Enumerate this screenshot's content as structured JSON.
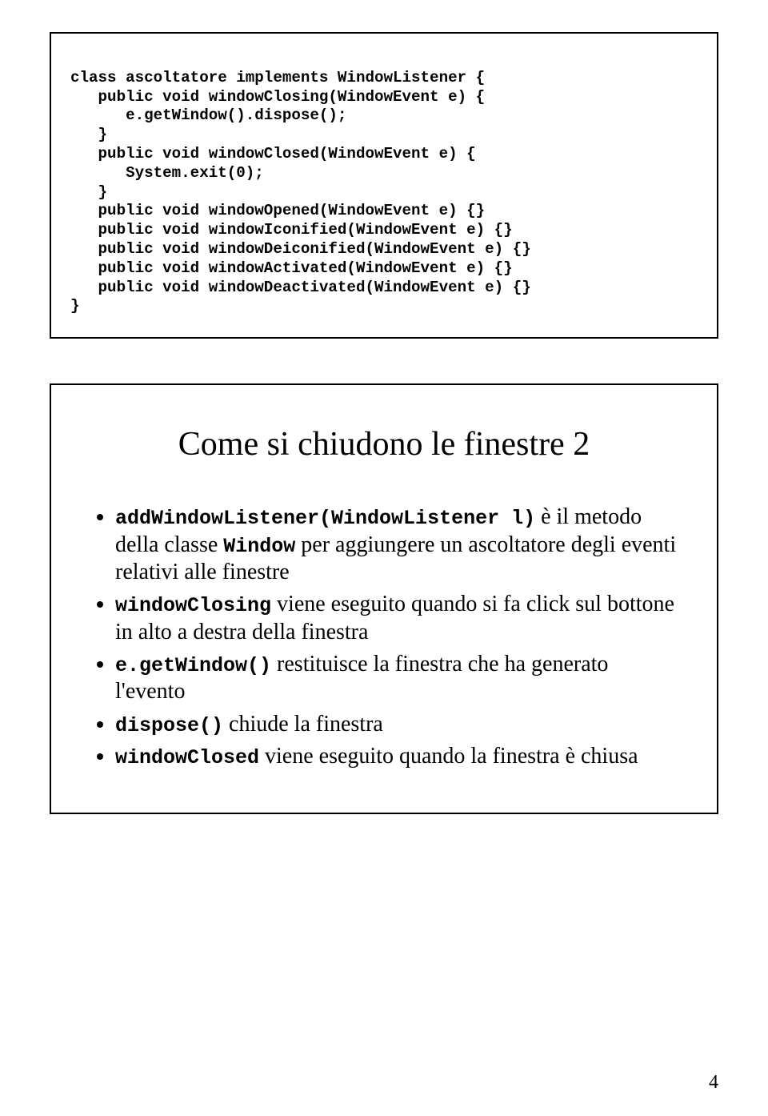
{
  "slide1": {
    "l1": "class ascoltatore implements WindowListener {",
    "l2": "   public void windowClosing(WindowEvent e) {",
    "l3": "      e.getWindow().dispose();",
    "l4": "   }",
    "l5": "   public void windowClosed(WindowEvent e) {",
    "l6": "      System.exit(0);",
    "l7": "   }",
    "l8": "   public void windowOpened(WindowEvent e) {}",
    "l9": "   public void windowIconified(WindowEvent e) {}",
    "l10": "   public void windowDeiconified(WindowEvent e) {}",
    "l11": "   public void windowActivated(WindowEvent e) {}",
    "l12": "   public void windowDeactivated(WindowEvent e) {}",
    "l13": "}"
  },
  "slide2": {
    "title": "Come si chiudono le finestre 2",
    "b1": {
      "code": "addWindowListener(WindowListener l)",
      "t1": " è il metodo della classe ",
      "code2": "Window",
      "t2": " per aggiungere un ascoltatore degli eventi relativi alle finestre"
    },
    "b2": {
      "code": "windowClosing",
      "t": " viene eseguito quando si fa click sul bottone in alto a destra della finestra"
    },
    "b3": {
      "code": "e.getWindow()",
      "t": " restituisce la finestra che ha generato l'evento"
    },
    "b4": {
      "code": "dispose()",
      "t": " chiude la finestra"
    },
    "b5": {
      "code": "windowClosed",
      "t": " viene eseguito quando la finestra è chiusa"
    }
  },
  "page_number": "4"
}
